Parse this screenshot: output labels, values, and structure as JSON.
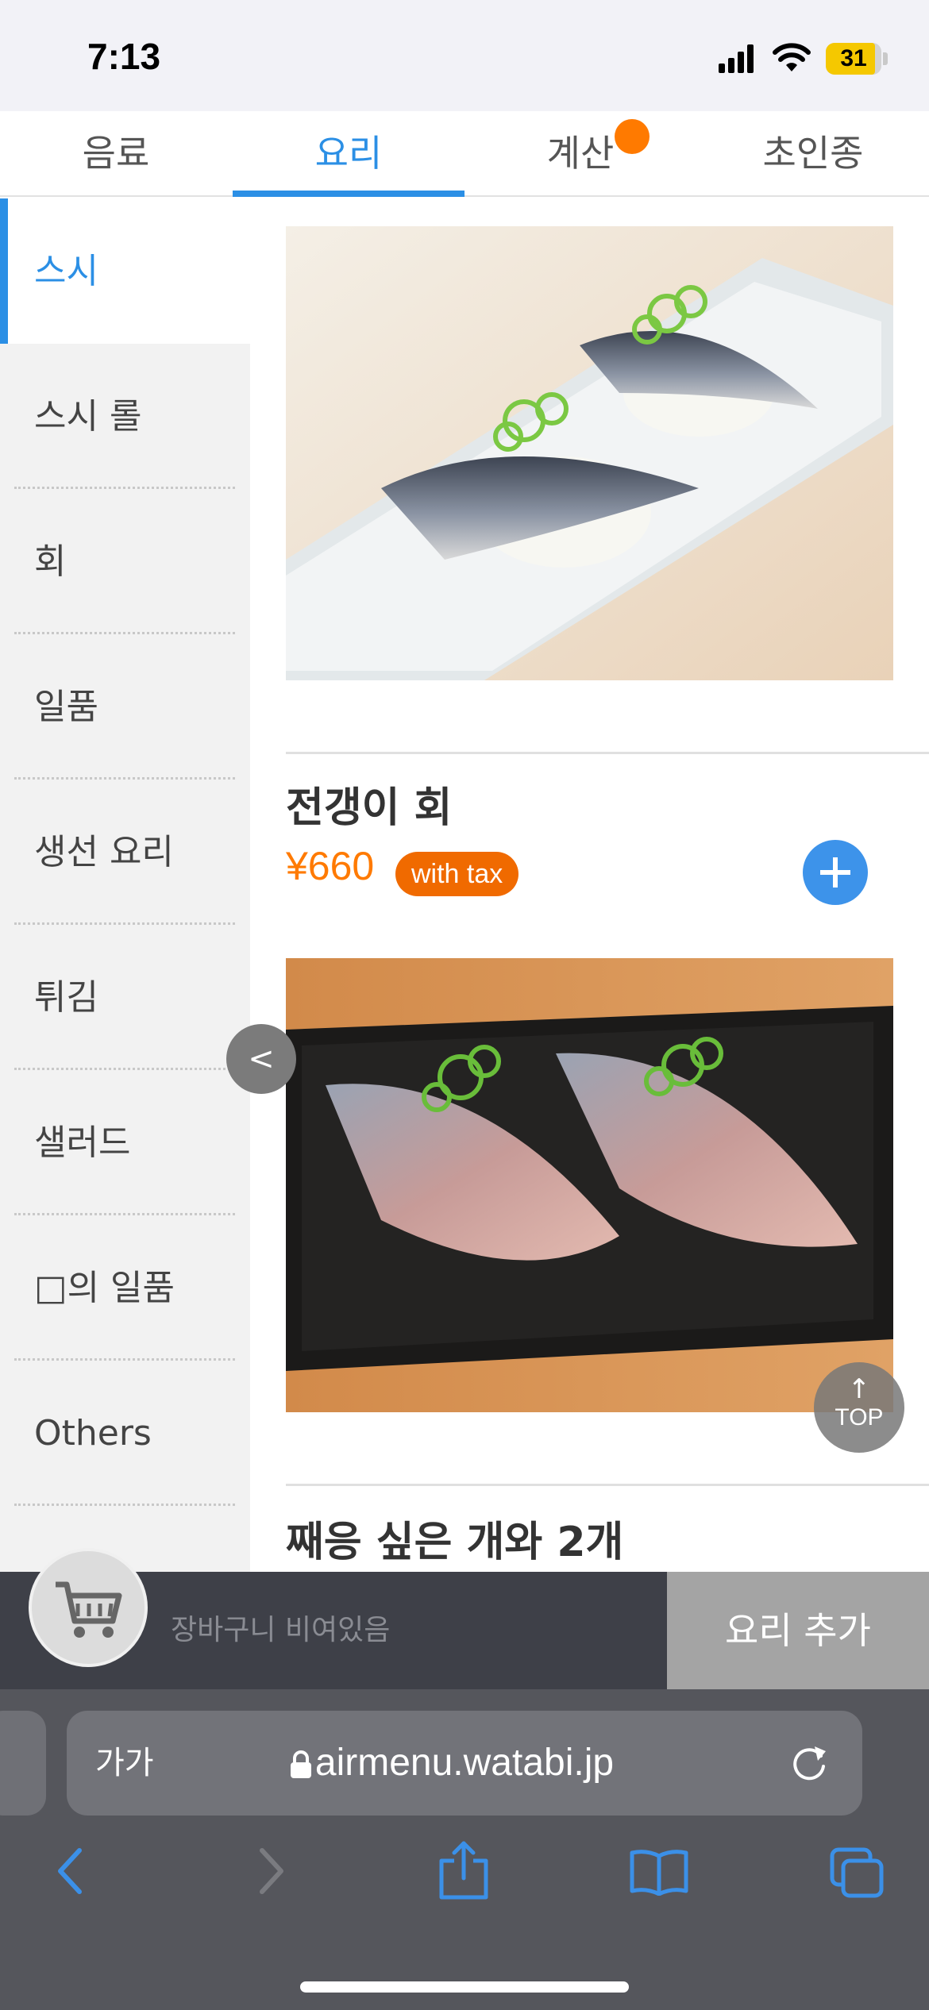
{
  "status": {
    "time": "7:13",
    "battery": "31"
  },
  "tabs": [
    {
      "label": "음료",
      "active": false
    },
    {
      "label": "요리",
      "active": true
    },
    {
      "label": "계산",
      "active": false
    },
    {
      "label": "초인종",
      "active": false
    }
  ],
  "sidebar": {
    "items": [
      {
        "label": "스시",
        "active": true
      },
      {
        "label": "스시 롤",
        "active": false
      },
      {
        "label": "회",
        "active": false
      },
      {
        "label": "일품",
        "active": false
      },
      {
        "label": "생선 요리",
        "active": false
      },
      {
        "label": "튀김",
        "active": false
      },
      {
        "label": "샐러드",
        "active": false
      },
      {
        "label": "□의 일품",
        "active": false
      },
      {
        "label": "Others",
        "active": false
      }
    ],
    "collapse_label": "<"
  },
  "menu": {
    "items": [
      {
        "name": "전갱이 회",
        "price": "¥660",
        "tax_label": "with tax"
      },
      {
        "name": "째응 싶은 개와   2개"
      }
    ],
    "top_label": "TOP"
  },
  "cart": {
    "empty_text": "장바구니 비여있음",
    "add_button": "요리 추가"
  },
  "browser": {
    "text_size_label": "가가",
    "url": "airmenu.watabi.jp"
  },
  "colors": {
    "accent": "#2b8fe5",
    "price": "#ff7a00",
    "badge": "#f06a00",
    "add_button": "#3d93ea"
  }
}
